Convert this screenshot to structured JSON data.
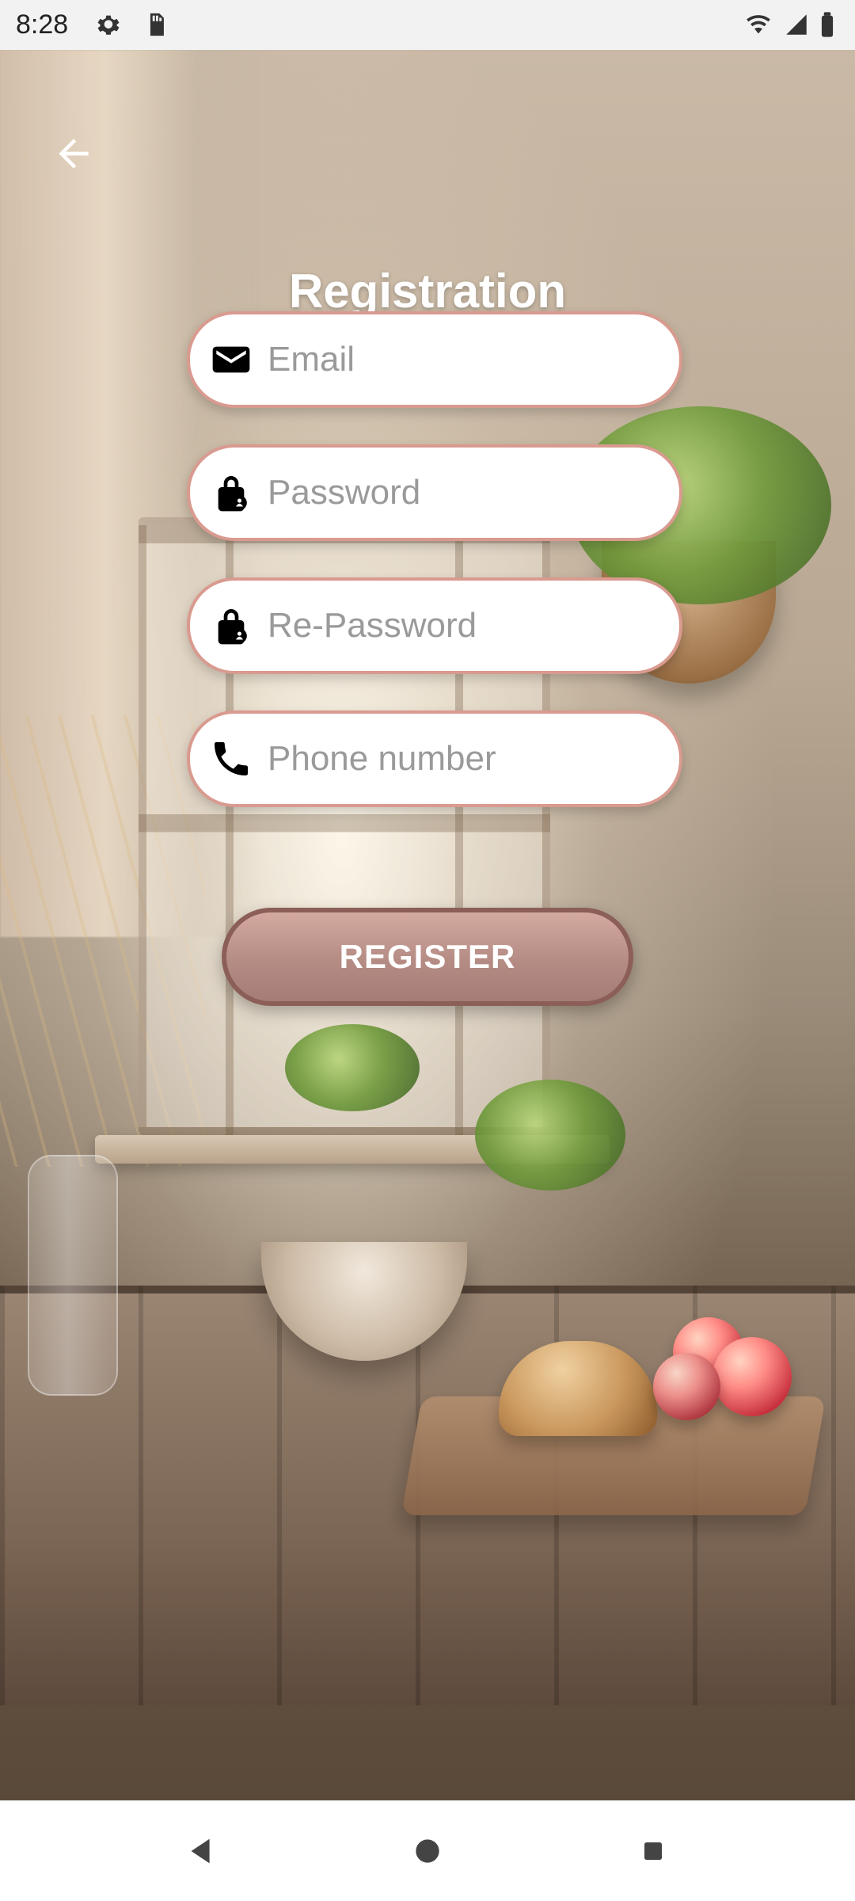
{
  "status": {
    "time": "8:28",
    "left_icons": [
      "gear-icon",
      "sd-card-icon"
    ],
    "right_icons": [
      "wifi-icon",
      "signal-icon",
      "battery-icon"
    ]
  },
  "header": {
    "back_icon": "arrow-left-icon",
    "title": "Registration"
  },
  "form": {
    "email": {
      "icon": "email-icon",
      "placeholder": "Email",
      "value": ""
    },
    "password": {
      "icon": "lock-icon",
      "placeholder": "Password",
      "value": ""
    },
    "repassword": {
      "icon": "lock-icon",
      "placeholder": "Re-Password",
      "value": ""
    },
    "phone": {
      "icon": "phone-icon",
      "placeholder": "Phone number",
      "value": ""
    }
  },
  "actions": {
    "register_label": "REGISTER"
  },
  "navigation": {
    "buttons": [
      "back-triangle-icon",
      "home-circle-icon",
      "recents-square-icon"
    ]
  },
  "colors": {
    "field_border": "#d99a8f",
    "register_fill": "#b58c84",
    "register_border": "#8b5f57"
  }
}
